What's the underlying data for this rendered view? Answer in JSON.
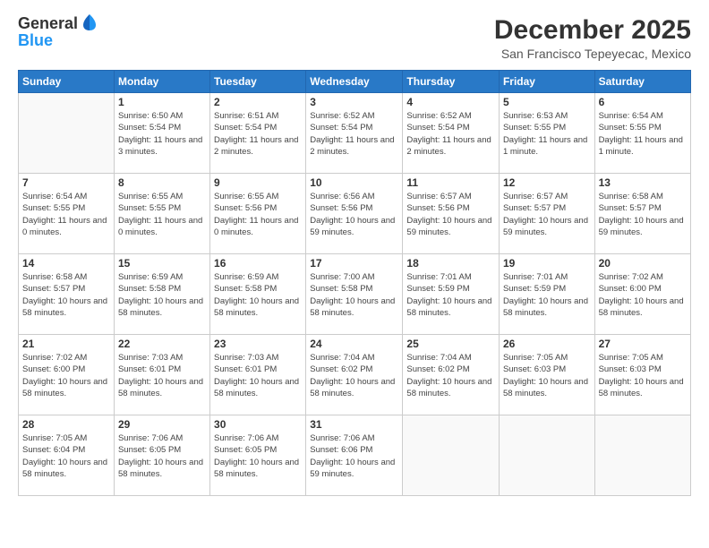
{
  "header": {
    "logo_line1": "General",
    "logo_line2": "Blue",
    "month_year": "December 2025",
    "location": "San Francisco Tepeyecac, Mexico"
  },
  "days_of_week": [
    "Sunday",
    "Monday",
    "Tuesday",
    "Wednesday",
    "Thursday",
    "Friday",
    "Saturday"
  ],
  "weeks": [
    [
      {
        "day": "",
        "sunrise": "",
        "sunset": "",
        "daylight": ""
      },
      {
        "day": "1",
        "sunrise": "Sunrise: 6:50 AM",
        "sunset": "Sunset: 5:54 PM",
        "daylight": "Daylight: 11 hours and 3 minutes."
      },
      {
        "day": "2",
        "sunrise": "Sunrise: 6:51 AM",
        "sunset": "Sunset: 5:54 PM",
        "daylight": "Daylight: 11 hours and 2 minutes."
      },
      {
        "day": "3",
        "sunrise": "Sunrise: 6:52 AM",
        "sunset": "Sunset: 5:54 PM",
        "daylight": "Daylight: 11 hours and 2 minutes."
      },
      {
        "day": "4",
        "sunrise": "Sunrise: 6:52 AM",
        "sunset": "Sunset: 5:54 PM",
        "daylight": "Daylight: 11 hours and 2 minutes."
      },
      {
        "day": "5",
        "sunrise": "Sunrise: 6:53 AM",
        "sunset": "Sunset: 5:55 PM",
        "daylight": "Daylight: 11 hours and 1 minute."
      },
      {
        "day": "6",
        "sunrise": "Sunrise: 6:54 AM",
        "sunset": "Sunset: 5:55 PM",
        "daylight": "Daylight: 11 hours and 1 minute."
      }
    ],
    [
      {
        "day": "7",
        "sunrise": "Sunrise: 6:54 AM",
        "sunset": "Sunset: 5:55 PM",
        "daylight": "Daylight: 11 hours and 0 minutes."
      },
      {
        "day": "8",
        "sunrise": "Sunrise: 6:55 AM",
        "sunset": "Sunset: 5:55 PM",
        "daylight": "Daylight: 11 hours and 0 minutes."
      },
      {
        "day": "9",
        "sunrise": "Sunrise: 6:55 AM",
        "sunset": "Sunset: 5:56 PM",
        "daylight": "Daylight: 11 hours and 0 minutes."
      },
      {
        "day": "10",
        "sunrise": "Sunrise: 6:56 AM",
        "sunset": "Sunset: 5:56 PM",
        "daylight": "Daylight: 10 hours and 59 minutes."
      },
      {
        "day": "11",
        "sunrise": "Sunrise: 6:57 AM",
        "sunset": "Sunset: 5:56 PM",
        "daylight": "Daylight: 10 hours and 59 minutes."
      },
      {
        "day": "12",
        "sunrise": "Sunrise: 6:57 AM",
        "sunset": "Sunset: 5:57 PM",
        "daylight": "Daylight: 10 hours and 59 minutes."
      },
      {
        "day": "13",
        "sunrise": "Sunrise: 6:58 AM",
        "sunset": "Sunset: 5:57 PM",
        "daylight": "Daylight: 10 hours and 59 minutes."
      }
    ],
    [
      {
        "day": "14",
        "sunrise": "Sunrise: 6:58 AM",
        "sunset": "Sunset: 5:57 PM",
        "daylight": "Daylight: 10 hours and 58 minutes."
      },
      {
        "day": "15",
        "sunrise": "Sunrise: 6:59 AM",
        "sunset": "Sunset: 5:58 PM",
        "daylight": "Daylight: 10 hours and 58 minutes."
      },
      {
        "day": "16",
        "sunrise": "Sunrise: 6:59 AM",
        "sunset": "Sunset: 5:58 PM",
        "daylight": "Daylight: 10 hours and 58 minutes."
      },
      {
        "day": "17",
        "sunrise": "Sunrise: 7:00 AM",
        "sunset": "Sunset: 5:58 PM",
        "daylight": "Daylight: 10 hours and 58 minutes."
      },
      {
        "day": "18",
        "sunrise": "Sunrise: 7:01 AM",
        "sunset": "Sunset: 5:59 PM",
        "daylight": "Daylight: 10 hours and 58 minutes."
      },
      {
        "day": "19",
        "sunrise": "Sunrise: 7:01 AM",
        "sunset": "Sunset: 5:59 PM",
        "daylight": "Daylight: 10 hours and 58 minutes."
      },
      {
        "day": "20",
        "sunrise": "Sunrise: 7:02 AM",
        "sunset": "Sunset: 6:00 PM",
        "daylight": "Daylight: 10 hours and 58 minutes."
      }
    ],
    [
      {
        "day": "21",
        "sunrise": "Sunrise: 7:02 AM",
        "sunset": "Sunset: 6:00 PM",
        "daylight": "Daylight: 10 hours and 58 minutes."
      },
      {
        "day": "22",
        "sunrise": "Sunrise: 7:03 AM",
        "sunset": "Sunset: 6:01 PM",
        "daylight": "Daylight: 10 hours and 58 minutes."
      },
      {
        "day": "23",
        "sunrise": "Sunrise: 7:03 AM",
        "sunset": "Sunset: 6:01 PM",
        "daylight": "Daylight: 10 hours and 58 minutes."
      },
      {
        "day": "24",
        "sunrise": "Sunrise: 7:04 AM",
        "sunset": "Sunset: 6:02 PM",
        "daylight": "Daylight: 10 hours and 58 minutes."
      },
      {
        "day": "25",
        "sunrise": "Sunrise: 7:04 AM",
        "sunset": "Sunset: 6:02 PM",
        "daylight": "Daylight: 10 hours and 58 minutes."
      },
      {
        "day": "26",
        "sunrise": "Sunrise: 7:05 AM",
        "sunset": "Sunset: 6:03 PM",
        "daylight": "Daylight: 10 hours and 58 minutes."
      },
      {
        "day": "27",
        "sunrise": "Sunrise: 7:05 AM",
        "sunset": "Sunset: 6:03 PM",
        "daylight": "Daylight: 10 hours and 58 minutes."
      }
    ],
    [
      {
        "day": "28",
        "sunrise": "Sunrise: 7:05 AM",
        "sunset": "Sunset: 6:04 PM",
        "daylight": "Daylight: 10 hours and 58 minutes."
      },
      {
        "day": "29",
        "sunrise": "Sunrise: 7:06 AM",
        "sunset": "Sunset: 6:05 PM",
        "daylight": "Daylight: 10 hours and 58 minutes."
      },
      {
        "day": "30",
        "sunrise": "Sunrise: 7:06 AM",
        "sunset": "Sunset: 6:05 PM",
        "daylight": "Daylight: 10 hours and 58 minutes."
      },
      {
        "day": "31",
        "sunrise": "Sunrise: 7:06 AM",
        "sunset": "Sunset: 6:06 PM",
        "daylight": "Daylight: 10 hours and 59 minutes."
      },
      {
        "day": "",
        "sunrise": "",
        "sunset": "",
        "daylight": ""
      },
      {
        "day": "",
        "sunrise": "",
        "sunset": "",
        "daylight": ""
      },
      {
        "day": "",
        "sunrise": "",
        "sunset": "",
        "daylight": ""
      }
    ]
  ]
}
